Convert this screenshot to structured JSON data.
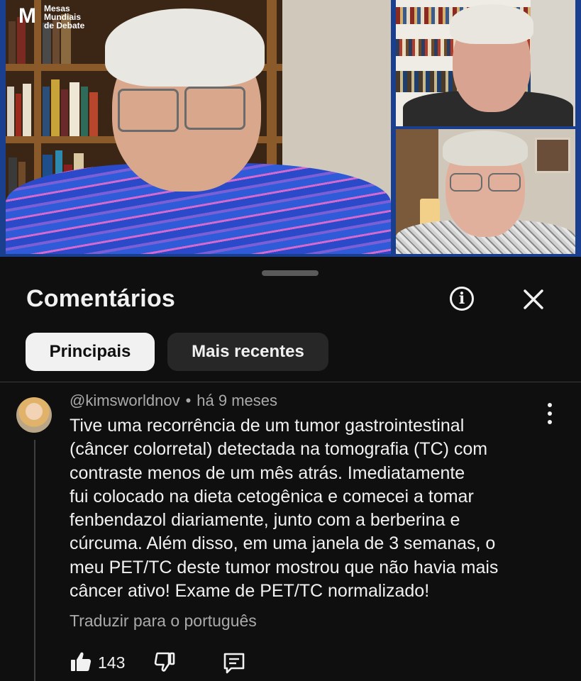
{
  "video": {
    "channel_logo": {
      "mark": "M",
      "lines": [
        "Mesas",
        "Mundiais",
        "de Debate"
      ]
    },
    "border_color": "#1a3f8f"
  },
  "sheet": {
    "title": "Comentários",
    "info_icon": "info-icon",
    "close_icon": "close-icon",
    "filters": [
      "Principais",
      "Mais recentes"
    ],
    "active_filter": "Principais"
  },
  "comment": {
    "author": "@kimsworldnov",
    "separator": "•",
    "time": "há 9 meses",
    "lines": [
      "Tive uma recorrência de um tumor gastrointestinal",
      "(câncer colorretal) detectada na tomografia (TC) com",
      "contraste menos de um mês atrás. Imediatamente",
      "fui colocado na dieta cetogênica e comecei a tomar",
      "fenbendazol diariamente, junto com a berberina e",
      "cúrcuma. Além disso, em uma janela de 3 semanas, o",
      "meu PET/TC deste tumor mostrou que não havia mais",
      "câncer ativo! Exame de PET/TC normalizado!"
    ],
    "translate": "Traduzir para o português",
    "likes": "143"
  }
}
